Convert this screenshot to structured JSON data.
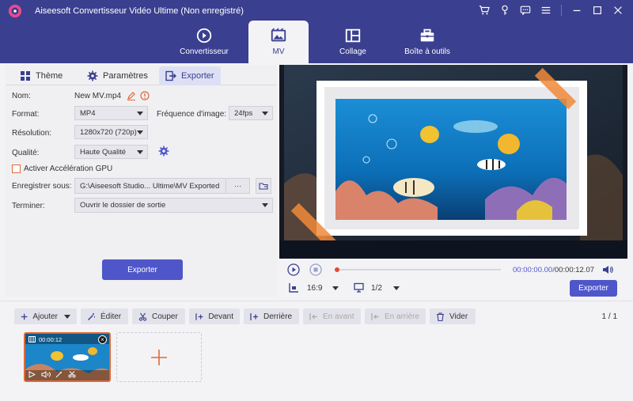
{
  "window": {
    "title": "Aiseesoft Convertisseur Vidéo Ultime (Non enregistré)",
    "controls": [
      "cart-icon",
      "key-icon",
      "chat-icon",
      "menu-icon",
      "minimize-icon",
      "maximize-icon",
      "close-icon"
    ]
  },
  "nav": {
    "tabs": [
      {
        "label": "Convertisseur",
        "icon": "converter-icon",
        "active": false
      },
      {
        "label": "MV",
        "icon": "mv-icon",
        "active": true
      },
      {
        "label": "Collage",
        "icon": "collage-icon",
        "active": false
      },
      {
        "label": "Boîte à outils",
        "icon": "toolbox-icon",
        "active": false
      }
    ]
  },
  "subtabs": [
    {
      "label": "Thème",
      "icon": "grid-icon",
      "active": false
    },
    {
      "label": "Paramètres",
      "icon": "gear-icon",
      "active": false
    },
    {
      "label": "Exporter",
      "icon": "export-icon",
      "active": true
    }
  ],
  "export_form": {
    "name_label": "Nom:",
    "name_value": "New MV.mp4",
    "format_label": "Format:",
    "format_value": "MP4",
    "framerate_label": "Fréquence d'image:",
    "framerate_value": "24fps",
    "resolution_label": "Résolution:",
    "resolution_value": "1280x720 (720p)",
    "quality_label": "Qualité:",
    "quality_value": "Haute Qualité",
    "gpu_label": "Activer Accélération GPU",
    "gpu_checked": false,
    "save_label": "Enregistrer sous:",
    "save_path": "G:\\Aiseesoft Studio... Ultime\\MV Exported",
    "browse_label": "···",
    "finish_label": "Terminer:",
    "finish_value": "Ouvrir le dossier de sortie",
    "export_button": "Exporter"
  },
  "player": {
    "time_current": "00:00:00.00",
    "time_total": "00:00:12.07",
    "time_separator": "/",
    "progress": 0.0,
    "aspect": "16:9",
    "page": "1/2",
    "export_button": "Exporter"
  },
  "timeline": {
    "buttons": [
      {
        "label": "Ajouter",
        "icon": "plus-icon",
        "enabled": true
      },
      {
        "label": "Éditer",
        "icon": "magic-wand-icon",
        "enabled": true
      },
      {
        "label": "Couper",
        "icon": "scissors-icon",
        "enabled": true
      },
      {
        "label": "Devant",
        "icon": "to-front-icon",
        "enabled": true
      },
      {
        "label": "Derrière",
        "icon": "to-back-icon",
        "enabled": true
      },
      {
        "label": "En avant",
        "icon": "forward-icon",
        "enabled": false
      },
      {
        "label": "En arrière",
        "icon": "backward-icon",
        "enabled": false
      },
      {
        "label": "Vider",
        "icon": "trash-icon",
        "enabled": true
      }
    ],
    "page_current": "1",
    "page_sep": "/",
    "page_total": "1",
    "clip_duration": "00:00:12"
  },
  "colors": {
    "titlebar": "#3b3f8f",
    "accent": "#4f56c9",
    "orange": "#e06a38"
  }
}
